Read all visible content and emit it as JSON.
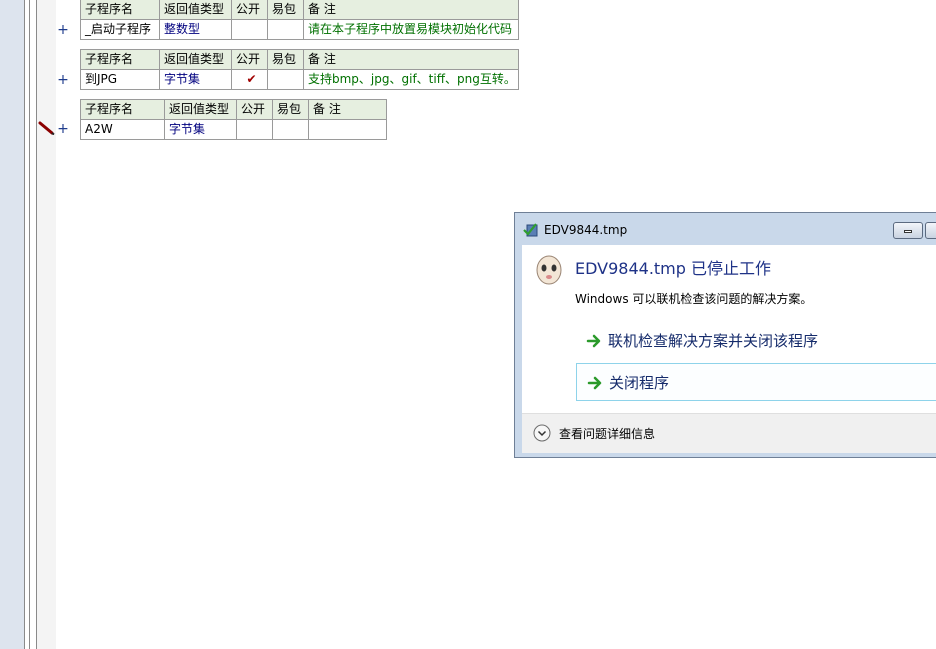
{
  "tables": [
    {
      "headers": [
        "子程序名",
        "返回值类型",
        "公开",
        "易包",
        "备 注"
      ],
      "row": {
        "name": "_启动子程序",
        "type": "整数型",
        "public": "",
        "easy_pkg": "",
        "note": "请在本子程序中放置易模块初始化代码"
      }
    },
    {
      "headers": [
        "子程序名",
        "返回值类型",
        "公开",
        "易包",
        "备 注"
      ],
      "row": {
        "name": "到JPG",
        "type": "字节集",
        "public": "✔",
        "easy_pkg": "",
        "note": "支持bmp、jpg、gif、tiff、png互转。"
      }
    },
    {
      "headers": [
        "子程序名",
        "返回值类型",
        "公开",
        "易包",
        "备 注"
      ],
      "row": {
        "name": "A2W",
        "type": "字节集",
        "public": "",
        "easy_pkg": "",
        "note": ""
      }
    }
  ],
  "plus_symbol": "+",
  "dialog": {
    "title": "EDV9844.tmp",
    "heading": "EDV9844.tmp 已停止工作",
    "description": "Windows 可以联机检查该问题的解决方案。",
    "option1": "联机检查解决方案并关闭该程序",
    "option2": "关闭程序",
    "details": "查看问题详细信息"
  },
  "colors": {
    "note_green": "#007000",
    "type_blue": "#00007f",
    "header_bg": "#e6efe0",
    "dialog_frame": "#c9d8ea",
    "heading_blue": "#1e3287"
  },
  "icons": [
    "pencil-icon",
    "app-icon",
    "green-arrow-icon",
    "expand-chevron-icon",
    "minimize-icon",
    "maximize-icon"
  ]
}
